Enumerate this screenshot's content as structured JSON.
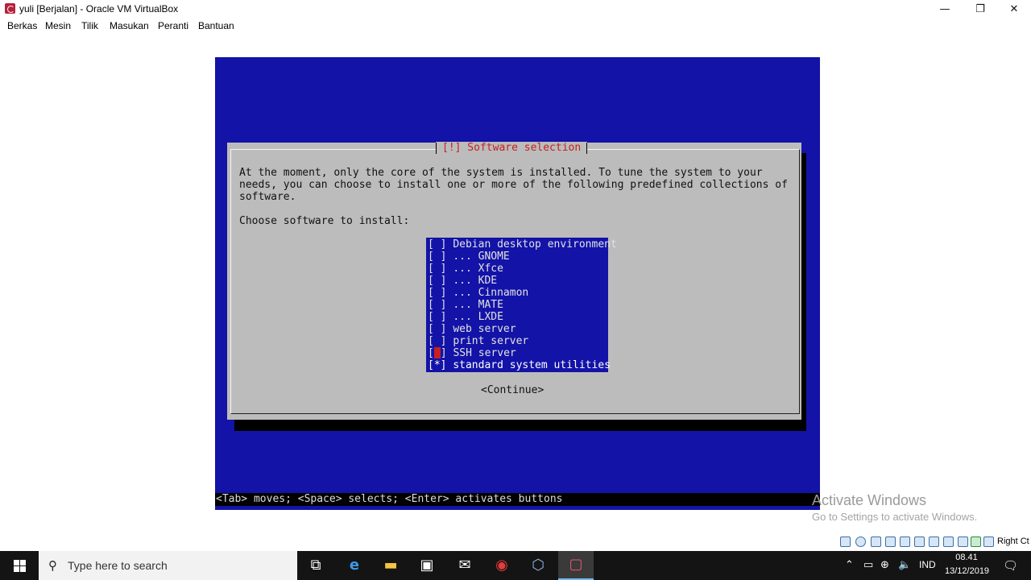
{
  "window": {
    "title": "yuli [Berjalan] - Oracle VM VirtualBox",
    "minimize_glyph": "—",
    "maximize_glyph": "❐",
    "close_glyph": "✕"
  },
  "menu": [
    "Berkas",
    "Mesin",
    "Tilik",
    "Masukan",
    "Peranti",
    "Bantuan"
  ],
  "installer": {
    "dialog_title": "[!] Software selection",
    "description_lines": [
      "At the moment, only the core of the system is installed. To tune the system to your",
      "needs, you can choose to install one or more of the following predefined collections of",
      "software."
    ],
    "prompt": "Choose software to install:",
    "software_items": [
      {
        "checkbox": "[ ]",
        "label": "Debian desktop environment",
        "checked": false
      },
      {
        "checkbox": "[ ]",
        "label": "... GNOME",
        "checked": false
      },
      {
        "checkbox": "[ ]",
        "label": "... Xfce",
        "checked": false
      },
      {
        "checkbox": "[ ]",
        "label": "... KDE",
        "checked": false
      },
      {
        "checkbox": "[ ]",
        "label": "... Cinnamon",
        "checked": false
      },
      {
        "checkbox": "[ ]",
        "label": "... MATE",
        "checked": false
      },
      {
        "checkbox": "[ ]",
        "label": "... LXDE",
        "checked": false
      },
      {
        "checkbox": "[ ]",
        "label": "web server",
        "checked": false
      },
      {
        "checkbox": "[ ]",
        "label": "print server",
        "checked": false
      },
      {
        "checkbox": "[ ]",
        "label": "SSH server",
        "checked": false,
        "cursor": true
      },
      {
        "checkbox": "[*]",
        "label": "standard system utilities",
        "checked": true
      }
    ],
    "continue_button": "<Continue>",
    "help_line": "<Tab> moves; <Space> selects; <Enter> activates buttons"
  },
  "watermark": {
    "line1": "Activate Windows",
    "line2": "Go to Settings to activate Windows."
  },
  "vbox_status": {
    "host_key": "Right Ct"
  },
  "taskbar": {
    "search_placeholder": "Type here to search",
    "search_icon": "search-icon",
    "apps": [
      "task-view-icon",
      "edge-icon",
      "file-explorer-icon",
      "store-icon",
      "mail-icon",
      "recorder-icon",
      "virtualbox-icon",
      "virtualbox-vm-icon"
    ],
    "language": "IND",
    "time": "08.41",
    "date": "13/12/2019"
  },
  "colors": {
    "installer_blue": "#1313a8",
    "dialog_gray": "#bcbcbc",
    "title_red": "#c62020",
    "taskbar": "#141414"
  }
}
